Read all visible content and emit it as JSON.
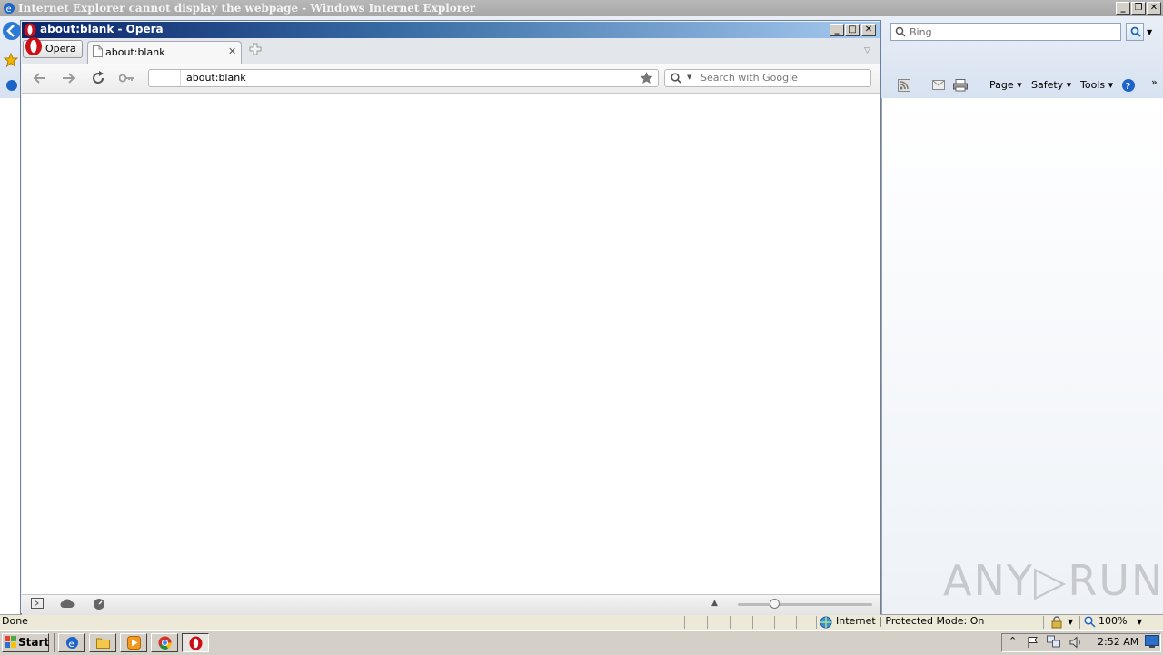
{
  "ie": {
    "title": "Internet Explorer cannot display the webpage - Windows Internet Explorer",
    "search_placeholder": "Bing",
    "commands": {
      "page": "Page ▾",
      "safety": "Safety ▾",
      "tools": "Tools ▾"
    },
    "status": {
      "text": "Done",
      "zone": "Internet | Protected Mode: On",
      "zoom": "100%"
    }
  },
  "opera": {
    "title": "about:blank - Opera",
    "menu_label": "Opera",
    "tab_label": "about:blank",
    "address_value": "about:blank",
    "search_placeholder": "Search with Google"
  },
  "taskbar": {
    "start_label": "Start",
    "clock": "2:52 AM"
  },
  "watermark": "ANY▷RUN",
  "colors": {
    "opera_red": "#cc0f16",
    "ie_blue": "#1d64c8",
    "opera_title_start": "#0a246a"
  }
}
